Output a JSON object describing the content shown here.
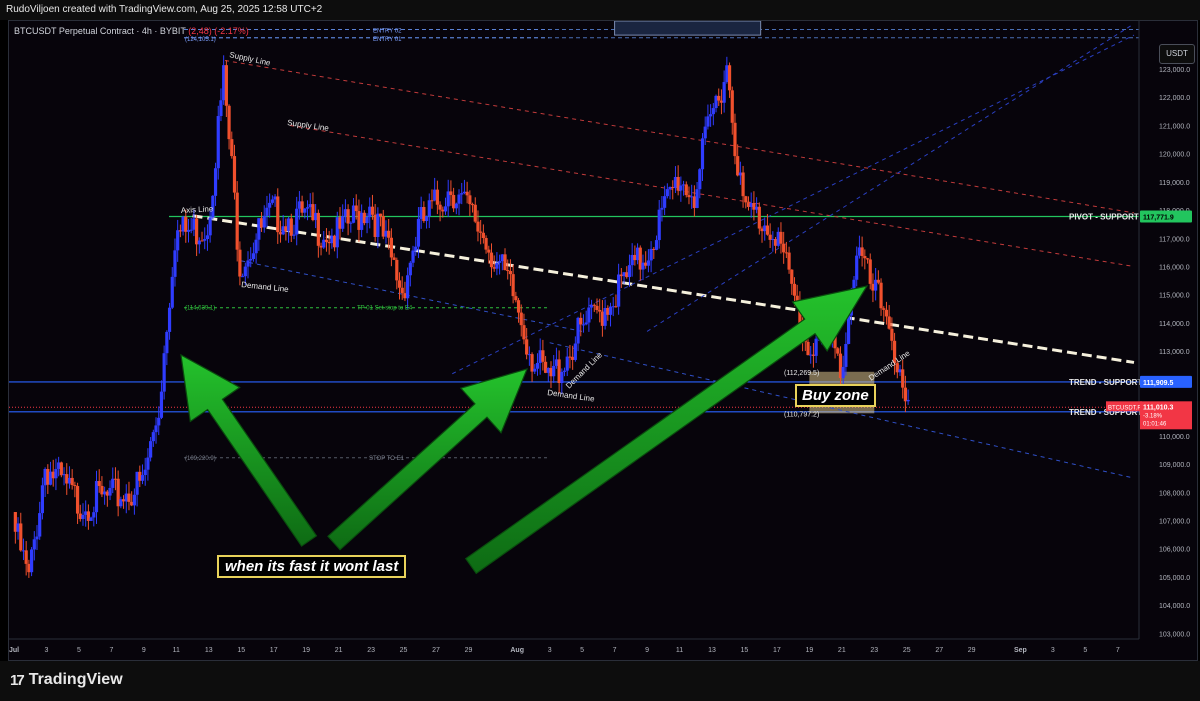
{
  "header": {
    "attribution": "RudoViljoen created with TradingView.com, Aug 25, 2025 12:58 UTC+2"
  },
  "symbol": {
    "title": "BTCUSDT Perpetual Contract · 4h · BYBIT",
    "change": "(2,48) (-2.17%)"
  },
  "currency": "USDT",
  "footer": {
    "brand": "TradingView",
    "logo_glyph": "17"
  },
  "annotations": {
    "callout_fast": "when its fast it wont last",
    "callout_buy": "Buy zone",
    "supply_line_1": "Supply Line",
    "supply_line_2": "Supply Line",
    "axis_line": "Axis Line",
    "demand_line_1": "Demand Line",
    "demand_line_2": "Demand Line",
    "demand_line_3": "Demand Line",
    "demand_line_4": "Demand Line",
    "entry_02": "ENTRY 02",
    "entry_01": "ENTRY 01",
    "entry_price": "(124,105.1)",
    "tp_label": "TP 01 Set stop to E4",
    "tp_price": "(114,539.1)",
    "stop_label": "STOP TO E1",
    "stop_price": "(109,220.9)",
    "buy_zone_top": "(112,269.5)",
    "buy_zone_bottom": "(110,797.2)"
  },
  "levels": {
    "pivot": {
      "label": "PIVOT - SUPPORT",
      "price": 117771.9,
      "badge": "117,771.9",
      "color": "#22c55e"
    },
    "trend_support_1": {
      "label": "TREND - SUPPORT",
      "price": 111909.5,
      "badge": "111,909.5",
      "color": "#2962ff"
    },
    "trend_support_2": {
      "label": "TREND - SUPPORT",
      "price": 110851.5,
      "badge": "110,851.5",
      "color": "#2962ff"
    },
    "last_price": {
      "symbol_tag": "BTCUSDT.P",
      "price": "111,010.3",
      "change": "-3.18%",
      "countdown": "01:01:46",
      "color": "#f23645"
    }
  },
  "chart_data": {
    "type": "candlestick",
    "title": "BTCUSDT Perpetual Contract · 4h · BYBIT",
    "xlabel": "",
    "ylabel": "",
    "ylim": [
      102800,
      124700
    ],
    "grid": false,
    "y_ticks": [
      "103,000.0",
      "104,000.0",
      "105,000.0",
      "106,000.0",
      "107,000.0",
      "108,000.0",
      "109,000.0",
      "110,000.0",
      "111,000.0",
      "112,000.0",
      "113,000.0",
      "114,000.0",
      "115,000.0",
      "116,000.0",
      "117,000.0",
      "118,000.0",
      "119,000.0",
      "120,000.0",
      "121,000.0",
      "122,000.0",
      "123,000.0"
    ],
    "x_ticks": [
      "Jul",
      "3",
      "5",
      "7",
      "9",
      "11",
      "13",
      "15",
      "17",
      "19",
      "21",
      "23",
      "25",
      "27",
      "29",
      "Aug",
      "3",
      "5",
      "7",
      "9",
      "11",
      "13",
      "15",
      "17",
      "19",
      "21",
      "23",
      "25",
      "27",
      "29",
      "Sep",
      "3",
      "5",
      "7"
    ],
    "x_start": "2025-07-01",
    "x_end": "2025-09-08",
    "close_path": [
      [
        "2025-07-01",
        107300
      ],
      [
        "2025-07-02",
        105200
      ],
      [
        "2025-07-03",
        109300
      ],
      [
        "2025-07-05",
        108000
      ],
      [
        "2025-07-07",
        108100
      ],
      [
        "2025-07-09",
        108600
      ],
      [
        "2025-07-10",
        111300
      ],
      [
        "2025-07-11",
        117500
      ],
      [
        "2025-07-12",
        117600
      ],
      [
        "2025-07-13",
        117800
      ],
      [
        "2025-07-14",
        123000
      ],
      [
        "2025-07-15",
        116500
      ],
      [
        "2025-07-17",
        118200
      ],
      [
        "2025-07-19",
        118000
      ],
      [
        "2025-07-21",
        117400
      ],
      [
        "2025-07-23",
        118600
      ],
      [
        "2025-07-25",
        115500
      ],
      [
        "2025-07-26",
        117700
      ],
      [
        "2025-07-28",
        119200
      ],
      [
        "2025-07-30",
        117500
      ],
      [
        "2025-08-01",
        115100
      ],
      [
        "2025-08-02",
        113200
      ],
      [
        "2025-08-03",
        112200
      ],
      [
        "2025-08-05",
        114000
      ],
      [
        "2025-08-07",
        115300
      ],
      [
        "2025-08-09",
        116800
      ],
      [
        "2025-08-11",
        119500
      ],
      [
        "2025-08-12",
        118900
      ],
      [
        "2025-08-13",
        121500
      ],
      [
        "2025-08-14",
        123500
      ],
      [
        "2025-08-15",
        118400
      ],
      [
        "2025-08-17",
        117700
      ],
      [
        "2025-08-18",
        115500
      ],
      [
        "2025-08-19",
        113400
      ],
      [
        "2025-08-20",
        114200
      ],
      [
        "2025-08-21",
        112600
      ],
      [
        "2025-08-22",
        117000
      ],
      [
        "2025-08-23",
        115400
      ],
      [
        "2025-08-24",
        114600
      ],
      [
        "2025-08-25",
        111000
      ]
    ]
  }
}
